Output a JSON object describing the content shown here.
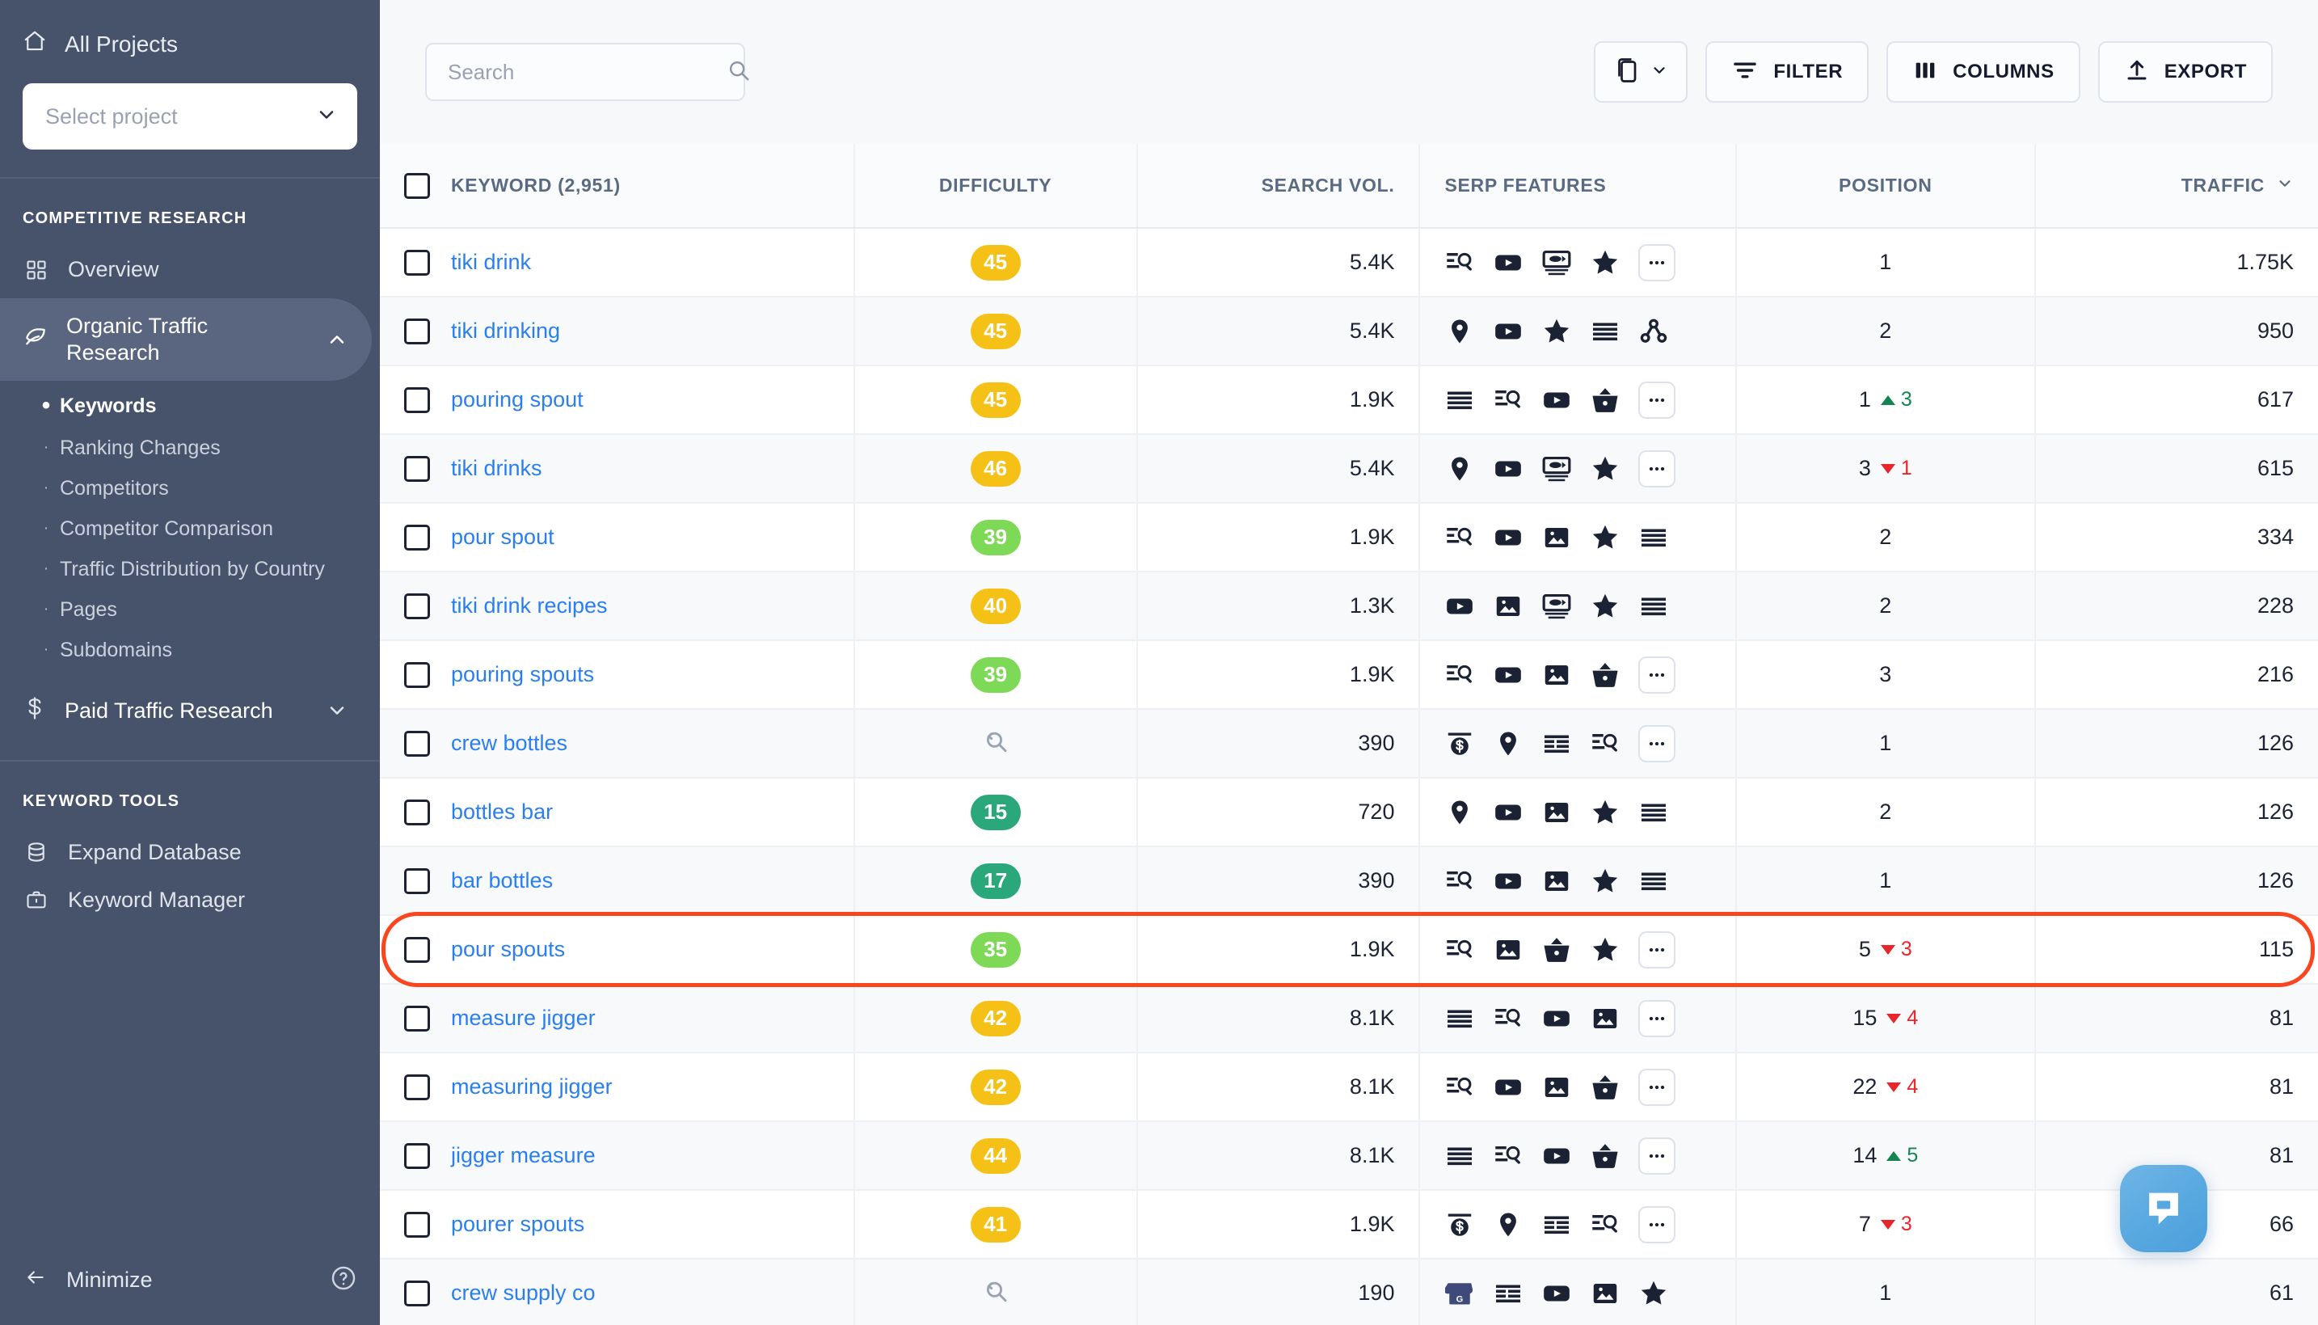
{
  "sidebar": {
    "all_projects": "All Projects",
    "project_select_placeholder": "Select project",
    "section_competitive": "COMPETITIVE RESEARCH",
    "overview": "Overview",
    "organic_group": "Organic Traffic Research",
    "sub_items": [
      "Keywords",
      "Ranking Changes",
      "Competitors",
      "Competitor Comparison",
      "Traffic Distribution by Country",
      "Pages",
      "Subdomains"
    ],
    "paid_group": "Paid Traffic Research",
    "section_keyword_tools": "KEYWORD TOOLS",
    "expand_database": "Expand Database",
    "keyword_manager": "Keyword Manager",
    "minimize": "Minimize"
  },
  "toolbar": {
    "search_placeholder": "Search",
    "search_value": "",
    "filter_label": "FILTER",
    "columns_label": "COLUMNS",
    "export_label": "EXPORT"
  },
  "table": {
    "headers": {
      "keyword": "KEYWORD  (2,951)",
      "difficulty": "DIFFICULTY",
      "search_vol": "SEARCH VOL.",
      "serp_features": "SERP FEATURES",
      "position": "POSITION",
      "traffic": "TRAFFIC"
    },
    "rows": [
      {
        "keyword": "tiki drink",
        "difficulty": "45",
        "diff_class": "b-yellow",
        "vol": "5.4K",
        "serp": [
          "snippet",
          "youtube",
          "video-carousel",
          "star",
          "more"
        ],
        "pos": "1",
        "delta": "",
        "dir": "",
        "traffic": "1.75K"
      },
      {
        "keyword": "tiki drinking",
        "difficulty": "45",
        "diff_class": "b-yellow",
        "vol": "5.4K",
        "serp": [
          "map-pin",
          "youtube",
          "star",
          "list",
          "related"
        ],
        "pos": "2",
        "delta": "",
        "dir": "",
        "traffic": "950"
      },
      {
        "keyword": "pouring spout",
        "difficulty": "45",
        "diff_class": "b-yellow",
        "vol": "1.9K",
        "serp": [
          "list",
          "snippet",
          "youtube",
          "shopping",
          "more"
        ],
        "pos": "1",
        "delta": "3",
        "dir": "up",
        "traffic": "617"
      },
      {
        "keyword": "tiki drinks",
        "difficulty": "46",
        "diff_class": "b-yellow",
        "vol": "5.4K",
        "serp": [
          "map-pin",
          "youtube",
          "video-carousel",
          "star",
          "more"
        ],
        "pos": "3",
        "delta": "1",
        "dir": "down",
        "traffic": "615"
      },
      {
        "keyword": "pour spout",
        "difficulty": "39",
        "diff_class": "b-lgreen",
        "vol": "1.9K",
        "serp": [
          "snippet",
          "youtube",
          "image",
          "star",
          "list"
        ],
        "pos": "2",
        "delta": "",
        "dir": "",
        "traffic": "334"
      },
      {
        "keyword": "tiki drink recipes",
        "difficulty": "40",
        "diff_class": "b-yellow",
        "vol": "1.3K",
        "serp": [
          "youtube",
          "image",
          "video-carousel",
          "star",
          "list"
        ],
        "pos": "2",
        "delta": "",
        "dir": "",
        "traffic": "228"
      },
      {
        "keyword": "pouring spouts",
        "difficulty": "39",
        "diff_class": "b-lgreen",
        "vol": "1.9K",
        "serp": [
          "snippet",
          "youtube",
          "image",
          "shopping",
          "more"
        ],
        "pos": "3",
        "delta": "",
        "dir": "",
        "traffic": "216"
      },
      {
        "keyword": "crew bottles",
        "difficulty": "",
        "diff_class": "none",
        "vol": "390",
        "serp": [
          "ads",
          "map-pin",
          "columns",
          "snippet",
          "more"
        ],
        "pos": "1",
        "delta": "",
        "dir": "",
        "traffic": "126"
      },
      {
        "keyword": "bottles bar",
        "difficulty": "15",
        "diff_class": "b-green",
        "vol": "720",
        "serp": [
          "map-pin",
          "youtube",
          "image",
          "star",
          "list"
        ],
        "pos": "2",
        "delta": "",
        "dir": "",
        "traffic": "126"
      },
      {
        "keyword": "bar bottles",
        "difficulty": "17",
        "diff_class": "b-green",
        "vol": "390",
        "serp": [
          "snippet",
          "youtube",
          "image",
          "star",
          "list"
        ],
        "pos": "1",
        "delta": "",
        "dir": "",
        "traffic": "126"
      },
      {
        "keyword": "pour spouts",
        "difficulty": "35",
        "diff_class": "b-lgreen",
        "vol": "1.9K",
        "serp": [
          "snippet",
          "image",
          "shopping",
          "star",
          "more"
        ],
        "pos": "5",
        "delta": "3",
        "dir": "down",
        "traffic": "115",
        "highlight": true
      },
      {
        "keyword": "measure jigger",
        "difficulty": "42",
        "diff_class": "b-yellow",
        "vol": "8.1K",
        "serp": [
          "list",
          "snippet",
          "youtube",
          "image",
          "more"
        ],
        "pos": "15",
        "delta": "4",
        "dir": "down",
        "traffic": "81"
      },
      {
        "keyword": "measuring jigger",
        "difficulty": "42",
        "diff_class": "b-yellow",
        "vol": "8.1K",
        "serp": [
          "snippet",
          "youtube",
          "image",
          "shopping",
          "more"
        ],
        "pos": "22",
        "delta": "4",
        "dir": "down",
        "traffic": "81"
      },
      {
        "keyword": "jigger measure",
        "difficulty": "44",
        "diff_class": "b-yellow",
        "vol": "8.1K",
        "serp": [
          "list",
          "snippet",
          "youtube",
          "shopping",
          "more"
        ],
        "pos": "14",
        "delta": "5",
        "dir": "up",
        "traffic": "81"
      },
      {
        "keyword": "pourer spouts",
        "difficulty": "41",
        "diff_class": "b-yellow",
        "vol": "1.9K",
        "serp": [
          "ads",
          "map-pin",
          "columns",
          "snippet",
          "more"
        ],
        "pos": "7",
        "delta": "3",
        "dir": "down",
        "traffic": "66"
      },
      {
        "keyword": "crew supply co",
        "difficulty": "",
        "diff_class": "none",
        "vol": "190",
        "serp": [
          "gmb",
          "columns",
          "youtube",
          "image",
          "star"
        ],
        "pos": "1",
        "delta": "",
        "dir": "",
        "traffic": "61"
      }
    ]
  },
  "colors": {
    "sidebar_bg": "#47536b",
    "link_blue": "#2a7ff0",
    "highlight_red": "#f9461e",
    "badge_yellow": "#f5c116",
    "badge_light_green": "#7ed957",
    "badge_green": "#2aa87c",
    "delta_up_green": "#148551",
    "delta_down_red": "#e8252a",
    "chat_blue": "#58a8e0"
  }
}
